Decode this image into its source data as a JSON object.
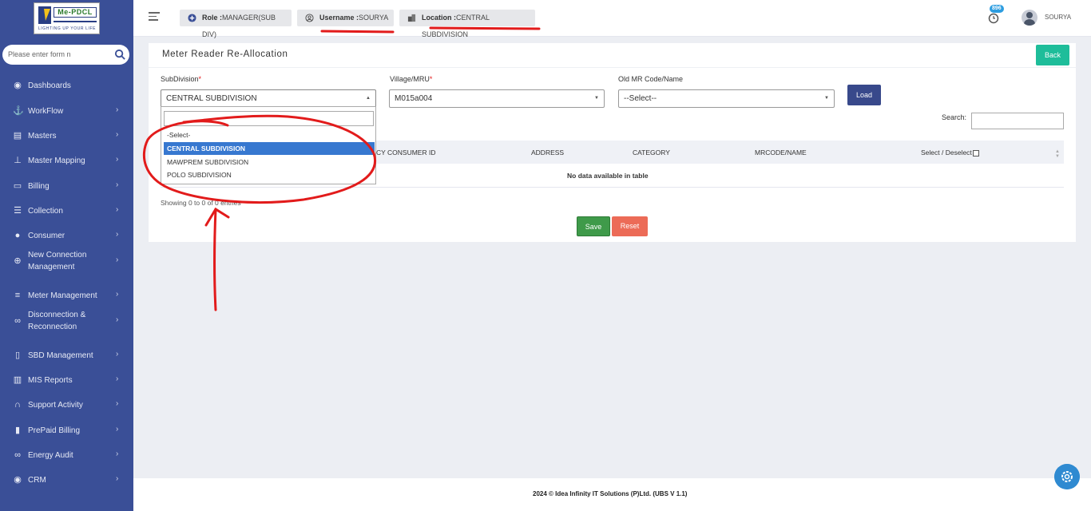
{
  "logo": {
    "title": "Me-PDCL",
    "tagline": "LIGHTING UP YOUR LIFE"
  },
  "sidebar": {
    "search_placeholder": "Please enter form n",
    "items": [
      {
        "label": "Dashboards",
        "icon": "palette-icon",
        "has_children": false
      },
      {
        "label": "WorkFlow",
        "icon": "anchor-icon",
        "has_children": true
      },
      {
        "label": "Masters",
        "icon": "list-icon",
        "has_children": true
      },
      {
        "label": "Master Mapping",
        "icon": "sitemap-icon",
        "has_children": true
      },
      {
        "label": "Billing",
        "icon": "monitor-icon",
        "has_children": true
      },
      {
        "label": "Collection",
        "icon": "list-ol-icon",
        "has_children": true
      },
      {
        "label": "Consumer",
        "icon": "user-icon",
        "has_children": true
      },
      {
        "label": "New Connection",
        "label2": "Management",
        "icon": "plus-circle-icon",
        "has_children": true
      },
      {
        "label": "Meter Management",
        "icon": "bars-icon",
        "has_children": true
      },
      {
        "label": "Disconnection &",
        "label2": "Reconnection",
        "icon": "link-icon",
        "has_children": true
      },
      {
        "label": "SBD Management",
        "icon": "mobile-icon",
        "has_children": true
      },
      {
        "label": "MIS Reports",
        "icon": "bar-chart-icon",
        "has_children": true
      },
      {
        "label": "Support Activity",
        "icon": "headset-icon",
        "has_children": true
      },
      {
        "label": "PrePaid Billing",
        "icon": "file-icon",
        "has_children": true
      },
      {
        "label": "Energy Audit",
        "icon": "link-icon",
        "has_children": true
      },
      {
        "label": "CRM",
        "icon": "palette-icon",
        "has_children": true
      }
    ]
  },
  "topbar": {
    "role_label": "Role :",
    "role_value": "MANAGER(SUB DIV)",
    "username_label": "Username :",
    "username_value": "SOURYA",
    "location_label": "Location :",
    "location_value": "CENTRAL SUBDIVISION",
    "notification_count": "896",
    "user_name": "SOURYA"
  },
  "page": {
    "title": "Meter Reader Re-Allocation",
    "back_label": "Back",
    "subdivision_label": "SubDivision",
    "subdivision_value": "CENTRAL SUBDIVISION",
    "village_label": "Village/MRU",
    "village_value": "M015a004",
    "old_mr_label": "Old MR Code/Name",
    "old_mr_value": "--Select--",
    "load_label": "Load",
    "search_label": "Search:",
    "required_mark": "*",
    "table_headers": [
      "CY CONSUMER ID",
      "ADDRESS",
      "CATEGORY",
      "MRCODE/NAME",
      "Select / Deselect"
    ],
    "empty_text": "No data available in table",
    "showing_text": "Showing 0 to 0 of 0 entries",
    "save_label": "Save",
    "reset_label": "Reset"
  },
  "dropdown": {
    "options": [
      "-Select-",
      "CENTRAL SUBDIVISION",
      "MAWPREM SUBDIVISION",
      "POLO SUBDIVISION"
    ],
    "selected_index": 1
  },
  "footer": {
    "text": "2024 © Idea Infinity IT Solutions (P)Ltd. (UBS V 1.1)"
  },
  "colors": {
    "sidebar": "#3a4f97",
    "accent": "#1ebd9a",
    "load": "#38498b",
    "save": "#3f9a4a",
    "reset": "#ec6b57",
    "annotation": "#e21b1b"
  }
}
